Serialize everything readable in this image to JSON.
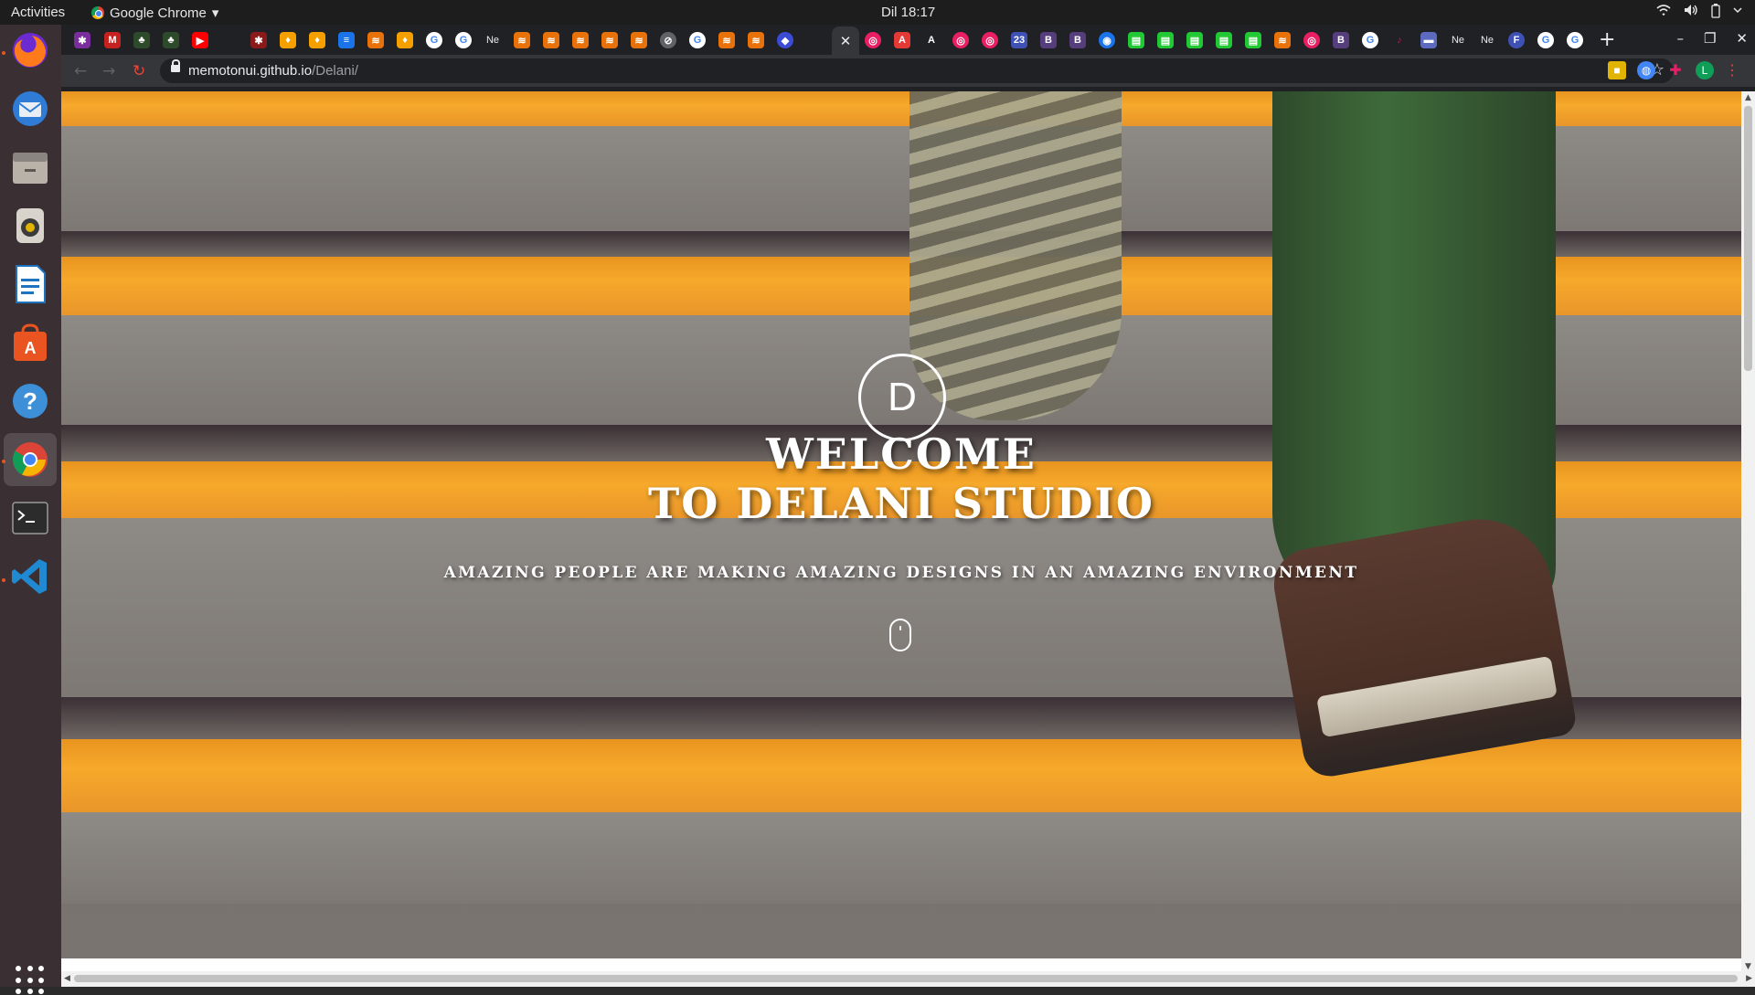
{
  "system_bar": {
    "activities": "Activities",
    "app_name": "Google Chrome",
    "app_menu_arrow": "▾",
    "clock": "Dil 18:17",
    "tray": [
      "wifi-icon",
      "volume-icon",
      "battery-icon",
      "power-menu-icon"
    ]
  },
  "dock": {
    "items": [
      "firefox-icon",
      "thunderbird-icon",
      "files-icon",
      "rhythmbox-icon",
      "libreoffice-writer-icon",
      "software-center-icon",
      "help-icon",
      "chrome-icon",
      "terminal-icon",
      "vscode-icon"
    ],
    "show_apps": "app-grid-icon"
  },
  "browser": {
    "active_tab_close": "✕",
    "new_tab": "+",
    "window_controls": {
      "minimize": "–",
      "maximize": "❐",
      "close": "✕"
    },
    "tab_letters": [
      "Ne",
      "A",
      "A",
      "23",
      "B",
      "B",
      "B",
      "Ne",
      "Ne",
      "F"
    ],
    "url": {
      "domain": "memotonui.github.io",
      "path": "/Delani/"
    },
    "bookmark_star": "☆",
    "profile_initial": "L"
  },
  "page": {
    "logo_letter": "D",
    "headline_line1": "WELCOME",
    "headline_line2": "TO DELANI STUDIO",
    "tagline": "AMAZING PEOPLE ARE MAKING AMAZING DESIGNS IN AN AMAZING ENVIRONMENT",
    "scroll_indicator": "mouse-scroll-icon"
  },
  "colors": {
    "accent_orange": "#f6a92b",
    "dock_bg": "#3a2f33",
    "chrome_dark": "#202124",
    "leg_green": "#3e6a3a"
  }
}
